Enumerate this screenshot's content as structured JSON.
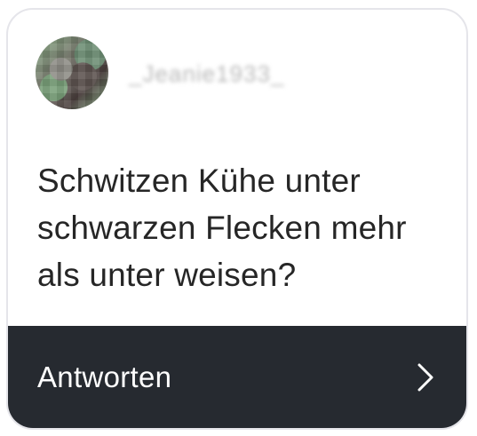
{
  "card": {
    "username": "_Jeanie1933_",
    "question": "Schwitzen Kühe unter schwarzen Flecken mehr als unter weisen?",
    "answer_label": "Antworten",
    "icons": {
      "avatar": "user-avatar",
      "chevron": "chevron-right-icon"
    },
    "colors": {
      "answer_bar_bg": "#262a30",
      "question_text": "#262626",
      "border": "#e5e5ea"
    }
  }
}
